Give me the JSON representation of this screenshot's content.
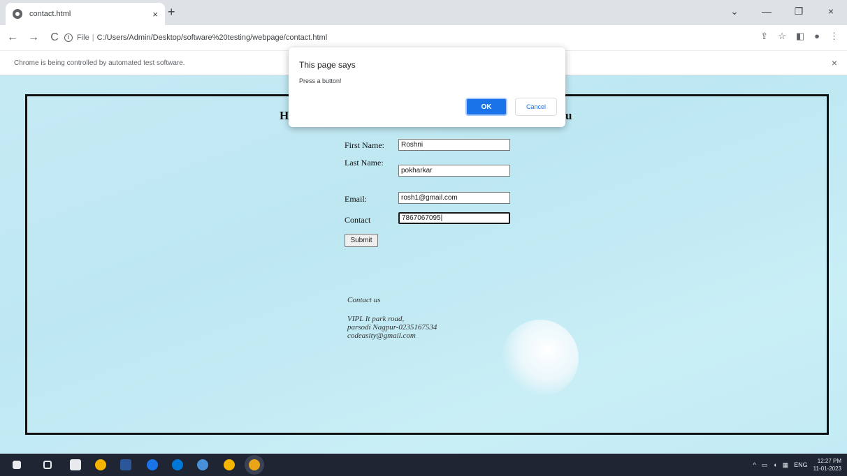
{
  "browser": {
    "tab_title": "contact.html",
    "tab_close": "×",
    "new_tab": "+",
    "win_minimize": "—",
    "win_restore": "❐",
    "win_close": "×",
    "back": "←",
    "forward": "→",
    "reload": "C",
    "url_scheme_label": "File",
    "url": "C:/Users/Admin/Desktop/software%20testing/webpage/contact.html",
    "infobar_text": "Chrome is being controlled by automated test software.",
    "infobar_close": "×"
  },
  "page": {
    "heading_left": "H",
    "heading_right": "u",
    "form": {
      "first_name_label": "First Name:",
      "first_name_value": "Roshni",
      "last_name_label": "Last Name:",
      "last_name_value": "pokharkar",
      "email_label": "Email:",
      "email_value": "rosh1@gmail.com",
      "contact_label": "Contact",
      "contact_value": "7867067095|",
      "submit_label": "Submit"
    },
    "contact_info": {
      "title": "Contact us",
      "line1": "VIPL It park road,",
      "line2": "parsodi Nagpur-0235167534",
      "line3": "codeasity@gmail.com"
    }
  },
  "dialog": {
    "title": "This page says",
    "message": "Press a button!",
    "ok_label": "OK",
    "cancel_label": "Cancel"
  },
  "taskbar": {
    "tray_text": "ENG",
    "time": "12:27 PM",
    "date": "11-01-2023"
  },
  "colors": {
    "accent": "#1a73e8",
    "page_bg": "#c6eaf4",
    "taskbar_bg": "#1f2533"
  }
}
